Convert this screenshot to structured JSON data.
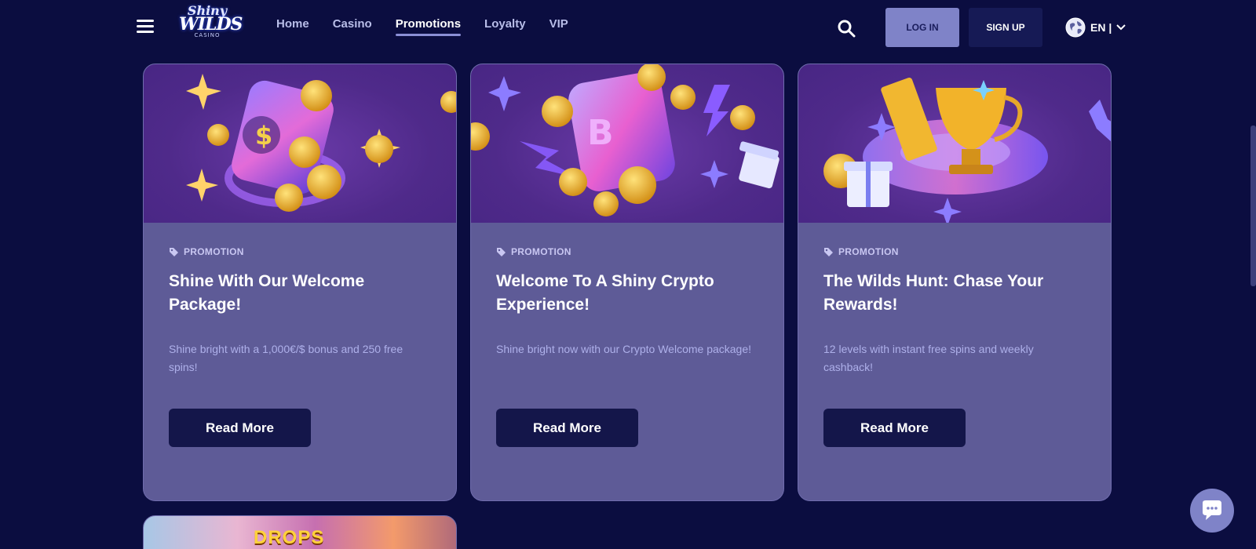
{
  "header": {
    "logo": {
      "line1": "Shiny",
      "line2": "WILDS",
      "line3": "CASINO"
    },
    "nav": [
      {
        "label": "Home",
        "active": false
      },
      {
        "label": "Casino",
        "active": false
      },
      {
        "label": "Promotions",
        "active": true
      },
      {
        "label": "Loyalty",
        "active": false
      },
      {
        "label": "VIP",
        "active": false
      }
    ],
    "login_label": "LOG IN",
    "signup_label": "SIGN UP",
    "language": "EN |"
  },
  "promotions": [
    {
      "tag": "PROMOTION",
      "title": "Shine With Our Welcome Package!",
      "description": "Shine bright with a 1,000€/$ bonus and 250 free spins!",
      "button_label": "Read More"
    },
    {
      "tag": "PROMOTION",
      "title": "Welcome To A Shiny Crypto Experience!",
      "description": "Shine bright now with our Crypto Welcome package!",
      "button_label": "Read More"
    },
    {
      "tag": "PROMOTION",
      "title": "The Wilds Hunt: Chase Your Rewards!",
      "description": "12 levels with instant free spins and weekly cashback!",
      "button_label": "Read More"
    }
  ],
  "partial_card": {
    "banner_text": "DROPS"
  },
  "colors": {
    "background": "#0b0d40",
    "card": "#5e5b97",
    "banner": "#4f2a8a",
    "button": "#14164a",
    "login_button": "#7f83c8"
  },
  "icons": [
    "menu-icon",
    "search-icon",
    "globe-icon",
    "chevron-down-icon",
    "tag-icon",
    "chat-icon"
  ]
}
